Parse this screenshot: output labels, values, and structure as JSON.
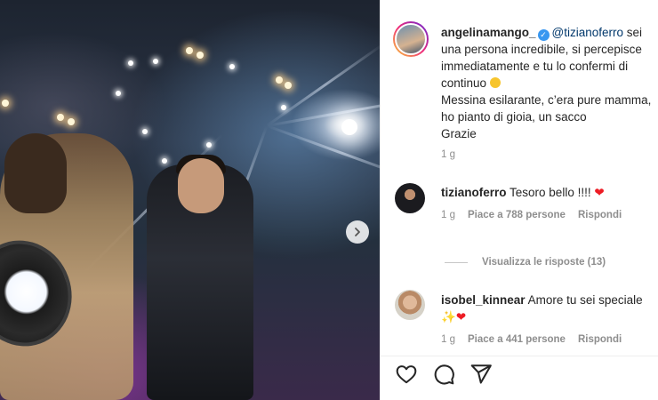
{
  "post": {
    "author": "angelinamango_",
    "verified": true,
    "mention": "@tizianoferro",
    "caption_line1": " sei una persona incredibile, si percepisce immediatamente e tu lo confermi di continuo ",
    "caption_line2": "Messina esilarante, c’era pure mamma, ho pianto di gioia, un sacco",
    "caption_line3": "Grazie",
    "time": "1 g"
  },
  "comments": [
    {
      "user": "tizianoferro",
      "text": "Tesoro bello !!!! ",
      "emoji": "❤",
      "time": "1 g",
      "likes": "Piace a 788 persone",
      "reply": "Rispondi",
      "view_replies": "Visualizza le risposte (13)"
    },
    {
      "user": "isobel_kinnear",
      "text": "Amore tu sei speciale",
      "emoji_sparkle": "✨",
      "emoji": "❤",
      "time": "1 g",
      "likes": "Piace a 441 persone",
      "reply": "Rispondi"
    }
  ],
  "icons": {
    "like": "heart-icon",
    "comment": "comment-icon",
    "share": "share-icon",
    "next": "chevron-right-icon"
  },
  "colors": {
    "mention": "#00376b",
    "secondary_text": "#8e8e8e",
    "verified": "#3897f0",
    "heart": "#ed1c24"
  }
}
